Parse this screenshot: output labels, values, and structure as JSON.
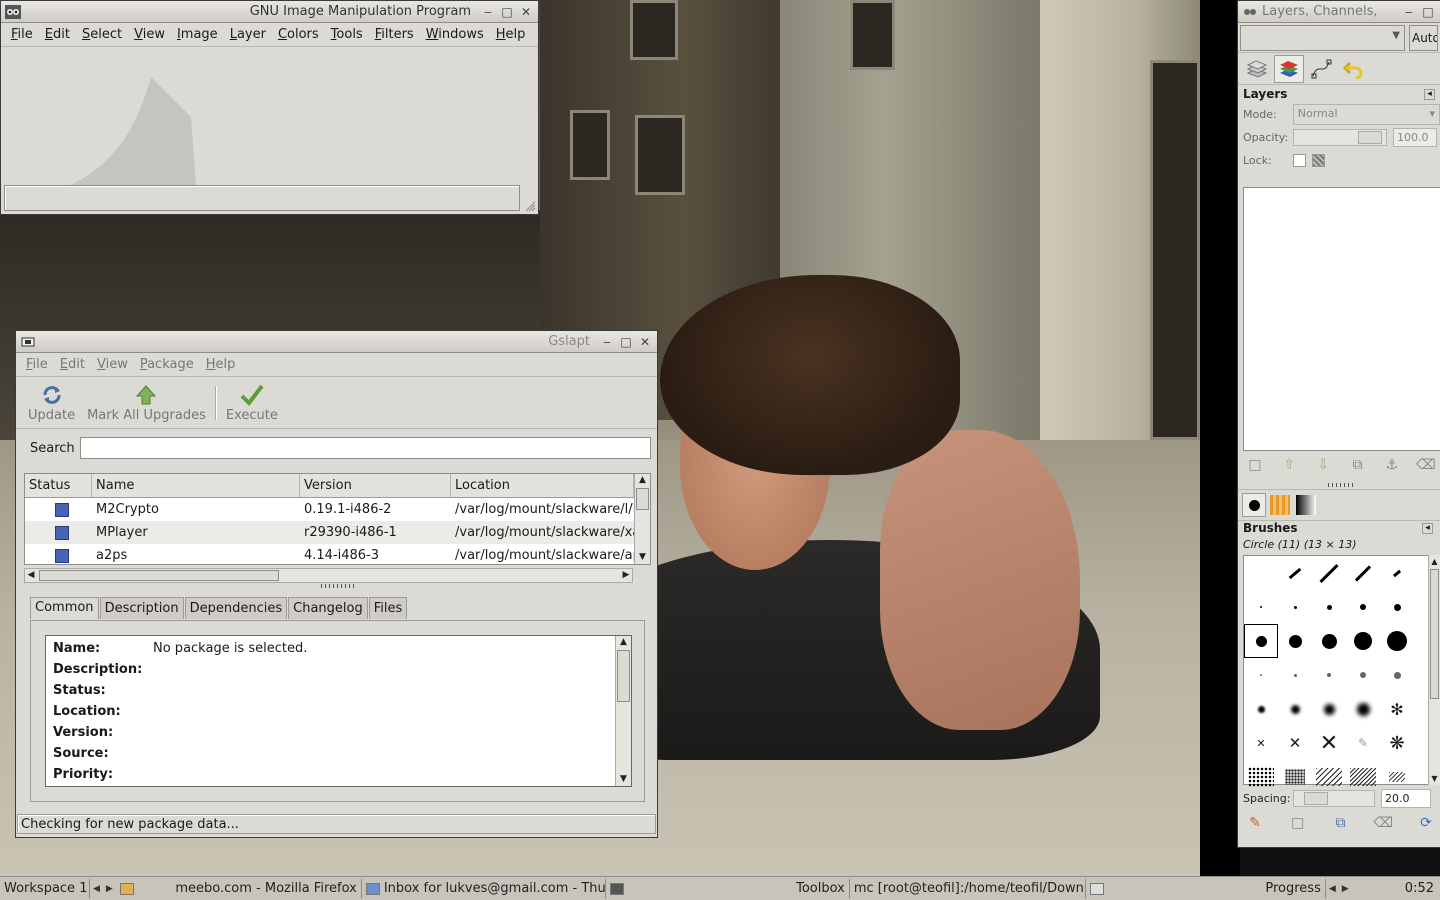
{
  "gimp_main": {
    "title": "GNU Image Manipulation Program",
    "menu": [
      "File",
      "Edit",
      "Select",
      "View",
      "Image",
      "Layer",
      "Colors",
      "Tools",
      "Filters",
      "Windows",
      "Help"
    ]
  },
  "gslapt": {
    "title": "Gslapt",
    "menu": [
      "File",
      "Edit",
      "View",
      "Package",
      "Help"
    ],
    "toolbar": {
      "update_label": "Update",
      "mark_all_label": "Mark All Upgrades",
      "execute_label": "Execute"
    },
    "search_label": "Search",
    "search_value": "",
    "columns": [
      "Status",
      "Name",
      "Version",
      "Location"
    ],
    "packages": [
      {
        "name": "M2Crypto",
        "version": "0.19.1-i486-2",
        "location": "/var/log/mount/slackware/l/M"
      },
      {
        "name": "MPlayer",
        "version": "r29390-i486-1",
        "location": "/var/log/mount/slackware/xa"
      },
      {
        "name": "a2ps",
        "version": "4.14-i486-3",
        "location": "/var/log/mount/slackware/ap"
      }
    ],
    "tabs": [
      "Common",
      "Description",
      "Dependencies",
      "Changelog",
      "Files"
    ],
    "details": {
      "name_key": "Name:",
      "name_value": "No package is selected.",
      "description_key": "Description:",
      "status_key": "Status:",
      "location_key": "Location:",
      "version_key": "Version:",
      "source_key": "Source:",
      "priority_key": "Priority:"
    },
    "statusbar": "Checking for new package data..."
  },
  "dock": {
    "title": "Layers, Channels,",
    "auto_button": "Auto",
    "layers_title": "Layers",
    "mode_label": "Mode:",
    "mode_value": "Normal",
    "opacity_label": "Opacity:",
    "opacity_value": "100.0",
    "lock_label": "Lock:",
    "brushes_title": "Brushes",
    "brush_name": "Circle (11) (13 × 13)",
    "spacing_label": "Spacing:",
    "spacing_value": "20.0"
  },
  "taskbar": {
    "workspace": "Workspace 1",
    "items": [
      "meebo.com - Mozilla Firefox",
      "Inbox for lukves@gmail.com - Thun",
      "Toolbox",
      "mc [root@teofil]:/home/teofil/Downl",
      "Progress"
    ],
    "clock": "0:52"
  },
  "colors": {
    "window_bg": "#dcdad5",
    "status_square": "#4863b5",
    "taskbar_bg": "#c7c4bc"
  }
}
